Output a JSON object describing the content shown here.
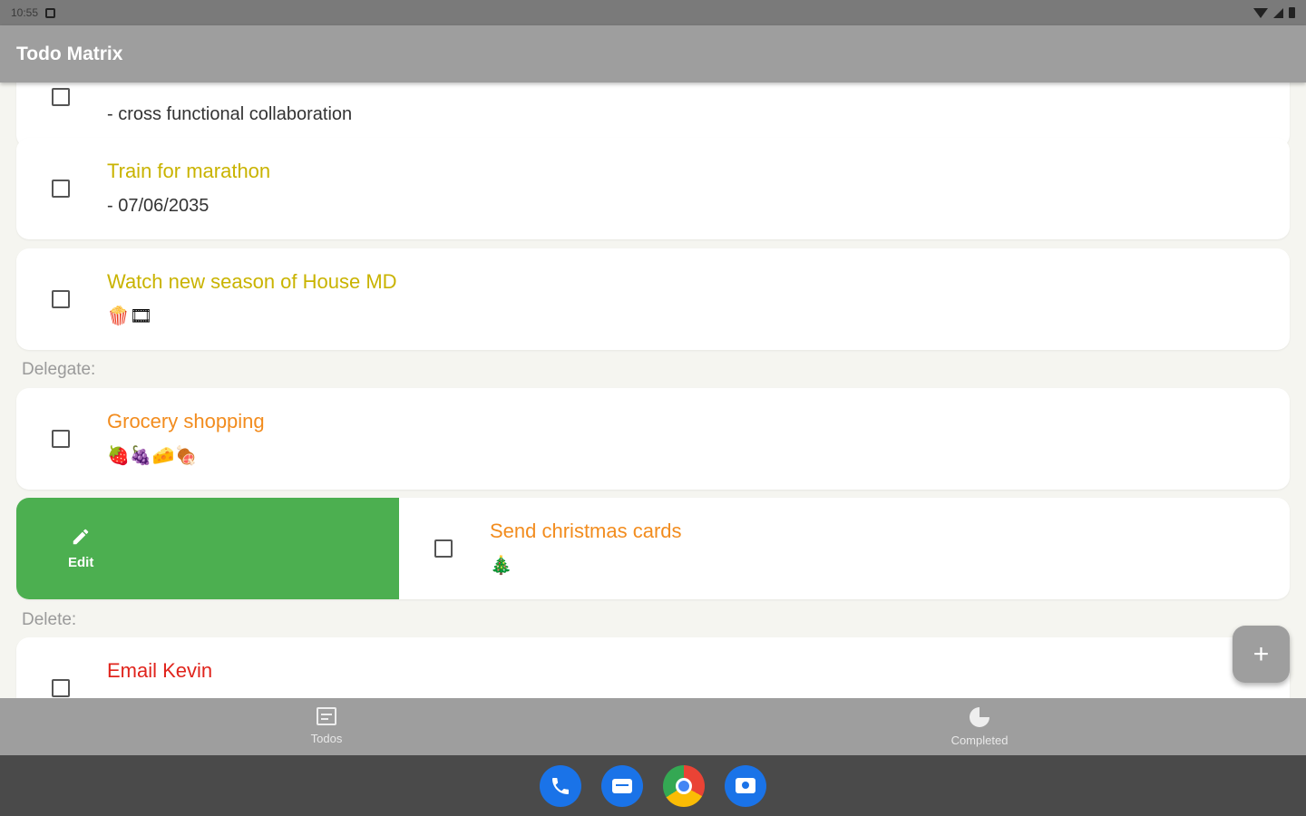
{
  "status_bar": {
    "time": "10:55"
  },
  "app_bar": {
    "title": "Todo Matrix"
  },
  "sections": {
    "delegate_label": "Delegate:",
    "delete_label": "Delete:"
  },
  "items": [
    {
      "title": "",
      "subtitle": "- cross functional collaboration"
    },
    {
      "title": "Train for marathon",
      "subtitle": "- 07/06/2035"
    },
    {
      "title": "Watch new season of House MD",
      "emoji": "🍿🎞"
    },
    {
      "title": "Grocery shopping",
      "emoji": "🍓🍇🧀🍖"
    },
    {
      "title": "Send christmas cards",
      "emoji": "🎄"
    },
    {
      "title": "Email Kevin",
      "subtitle": ""
    }
  ],
  "swipe_action": {
    "edit_label": "Edit"
  },
  "bottom_nav": {
    "todos_label": "Todos",
    "completed_label": "Completed"
  },
  "colors": {
    "schedule": "#c9b300",
    "delegate": "#f28c1e",
    "delete": "#e0241c",
    "edit_action": "#4caf50"
  }
}
